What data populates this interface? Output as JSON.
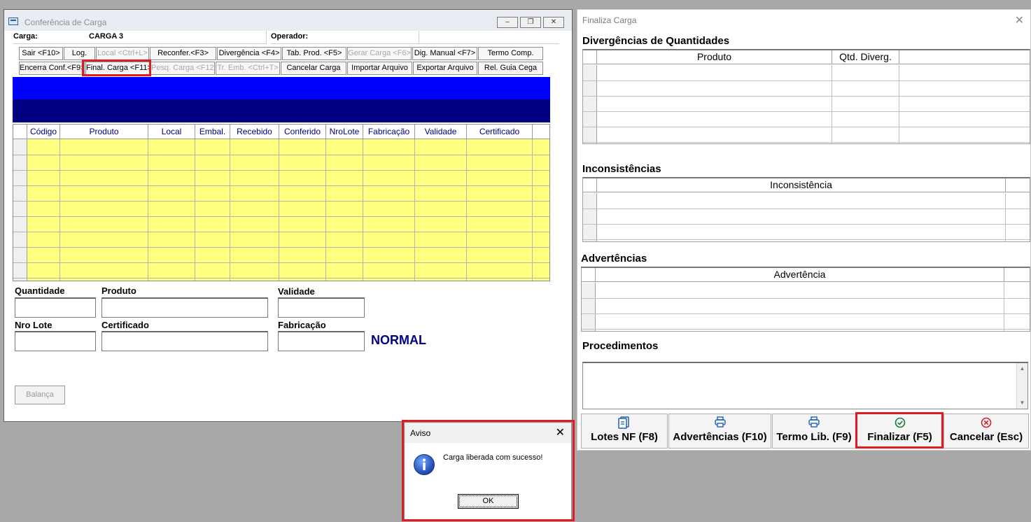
{
  "conferencia": {
    "title": "Conferência de Carga",
    "carga_label": "Carga:",
    "carga_value": "CARGA 3",
    "operador_label": "Operador:",
    "operador_value": "",
    "buttons_row1": [
      {
        "label": "Sair <F10>",
        "enabled": true
      },
      {
        "label": "Log.",
        "enabled": true
      },
      {
        "label": "Local <Ctrl+L>",
        "enabled": false
      },
      {
        "label": "Reconfer.<F3>",
        "enabled": true
      },
      {
        "label": "Divergência <F4>",
        "enabled": true
      },
      {
        "label": "Tab. Prod. <F5>",
        "enabled": true
      },
      {
        "label": "Gerar Carga <F6>",
        "enabled": false
      },
      {
        "label": "Dig. Manual <F7>",
        "enabled": true
      },
      {
        "label": "Termo Comp.",
        "enabled": true
      }
    ],
    "buttons_row2": [
      {
        "label": "Encerra Conf.<F9>",
        "enabled": true
      },
      {
        "label": "Final. Carga <F11>",
        "enabled": true
      },
      {
        "label": "Pesq. Carga <F12>",
        "enabled": false
      },
      {
        "label": "Tr. Emb. <Ctrl+T>",
        "enabled": false
      },
      {
        "label": "Cancelar Carga",
        "enabled": true
      },
      {
        "label": "Importar Arquivo",
        "enabled": true
      },
      {
        "label": "Exportar Arquivo",
        "enabled": true
      },
      {
        "label": "Rel. Guia Cega",
        "enabled": true
      }
    ],
    "grid_columns": [
      "Código",
      "Produto",
      "Local",
      "Embal.",
      "Recebido",
      "Conferido",
      "NroLote",
      "Fabricação",
      "Validade",
      "Certificado"
    ],
    "fields": {
      "quantidade": "Quantidade",
      "produto": "Produto",
      "validade": "Validade",
      "nro_lote": "Nro Lote",
      "certificado": "Certificado",
      "fabricacao": "Fabricação"
    },
    "status": "NORMAL",
    "balanca_label": "Balança",
    "colors": {
      "band_top": "#0000ff",
      "band_bottom": "#000080",
      "grid_bg": "#ffff80"
    }
  },
  "finaliza": {
    "title": "Finaliza Carga",
    "divergencias_title": "Divergências de Quantidades",
    "divergencias_cols": [
      "Produto",
      "Qtd. Diverg."
    ],
    "inconsistencias_title": "Inconsistências",
    "inconsistencias_cols": [
      "Inconsistência"
    ],
    "advertencias_title": "Advertências",
    "advertencias_cols": [
      "Advertência"
    ],
    "procedimentos_title": "Procedimentos",
    "buttons": [
      {
        "label": "Lotes NF (F8)",
        "icon": "documents-icon"
      },
      {
        "label": "Advertências (F10)",
        "icon": "printer-icon"
      },
      {
        "label": "Termo Lib. (F9)",
        "icon": "printer-icon"
      },
      {
        "label": "Finalizar (F5)",
        "icon": "check-circle-icon"
      },
      {
        "label": "Cancelar (Esc)",
        "icon": "x-circle-icon"
      }
    ]
  },
  "aviso": {
    "title": "Aviso",
    "message": "Carga liberada com sucesso!",
    "ok_label": "OK",
    "icon": "info-icon"
  },
  "highlight_color": "#e01b24"
}
